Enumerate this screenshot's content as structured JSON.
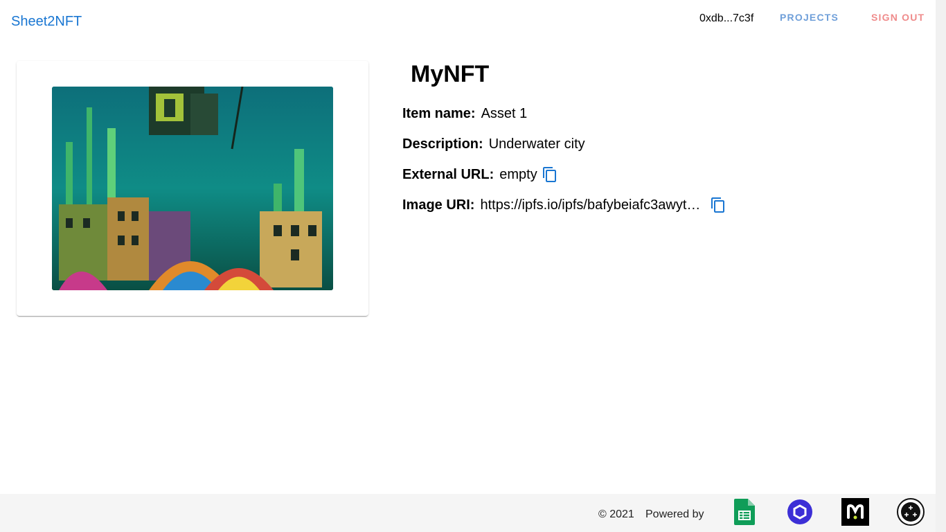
{
  "header": {
    "brand": "Sheet2NFT",
    "wallet": "0xdb...7c3f",
    "nav": {
      "projects": "PROJECTS",
      "sign_out": "SIGN OUT"
    }
  },
  "nft": {
    "title": "MyNFT",
    "image_icon": "nft-artwork-underwater-city",
    "fields": {
      "item_name": {
        "label": "Item name:",
        "value": "Asset 1"
      },
      "description": {
        "label": "Description:",
        "value": "Underwater city"
      },
      "external_url": {
        "label": "External URL:",
        "value": "empty"
      },
      "image_uri": {
        "label": "Image URI:",
        "value": "https://ipfs.io/ipfs/bafybeiafc3awyt…"
      }
    },
    "copy_icon": "content-copy-icon"
  },
  "footer": {
    "copyright": "© 2021",
    "powered_by": "Powered by",
    "partners": [
      "google-sheets-icon",
      "chainlink-icon",
      "magic-icon",
      "nft-storage-icon"
    ]
  },
  "colors": {
    "brand": "#1976d2",
    "projects": "#6f9fd9",
    "sign_out": "#ef8b8b",
    "copy_icon": "#1976d2",
    "footer_bg": "#f5f5f5"
  }
}
